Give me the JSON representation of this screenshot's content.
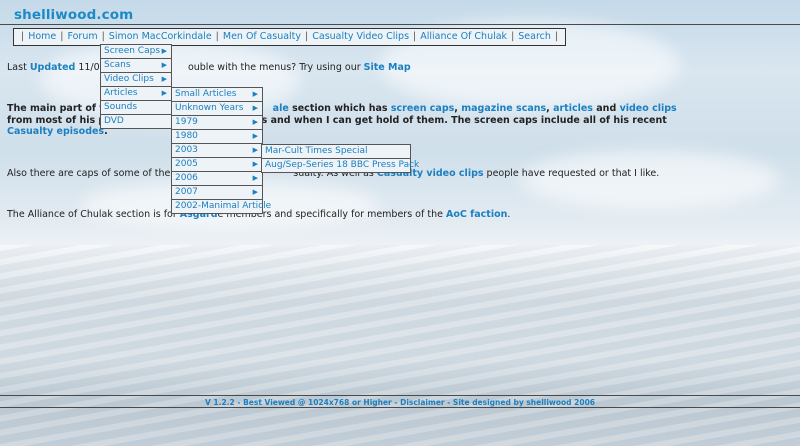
{
  "site": {
    "title": "shelliwood.com"
  },
  "nav": {
    "items": [
      "Home",
      "Forum",
      "Simon MacCorkindale",
      "Men Of Casualty",
      "Casualty Video Clips",
      "Alliance Of Chulak",
      "Search"
    ]
  },
  "menus": {
    "level1": [
      "Screen Caps",
      "Scans",
      "Video Clips",
      "Articles",
      "Sounds",
      "DVD"
    ],
    "level2": [
      "Small Articles",
      "Unknown Years",
      "1979",
      "1980",
      "2003",
      "2005",
      "2006",
      "2007",
      "2002-Manimal Article"
    ],
    "level3": [
      "Mar-Cult Times Special",
      "Aug/Sep-Series 18 BBC Press Pack"
    ]
  },
  "content": {
    "line1_a": "Last ",
    "line1_link": "Updated",
    "line1_b": " 11/07/",
    "line1_c": "ouble with the menus?  Try using our ",
    "line1_sitemap": "Site Map",
    "p2_a": "The main part of th",
    "p2_b": "ale",
    "p2_c": " section which has ",
    "p2_caps": "screen caps",
    "p2_comma1": ", ",
    "p2_scans": "magazine scans",
    "p2_comma2": ", ",
    "p2_articles": "articles",
    "p2_and": " and ",
    "p2_video": "video clips",
    "p3_a": "from most of his p",
    "p3_b": "as and when I can get hold of them. The screen caps include all of his recent",
    "p4_link": "Casualty episodes",
    "p4_dot": ".",
    "p5_a": "Also there are caps of some of the ",
    "p5_m": "m",
    "p5_b": "sualty.  As well as ",
    "p5_link": "Casualty video clips",
    "p5_c": " people have requested or that I like.",
    "p6_a": "The Alliance of Chulak section is for ",
    "p6_link": "Asgard",
    "p6_b": "e members and specifically for members of the ",
    "p6_link2": "AoC faction",
    "p6_dot": "."
  },
  "footer": {
    "text": "V 1.2.2 - Best Viewed @ 1024x768 or Higher - Disclaimer - Site designed by shelliwood 2006"
  },
  "colors": {
    "link": "#1b7fc0",
    "title": "#1b8ac7",
    "menu_bg": "#eef3f7"
  }
}
